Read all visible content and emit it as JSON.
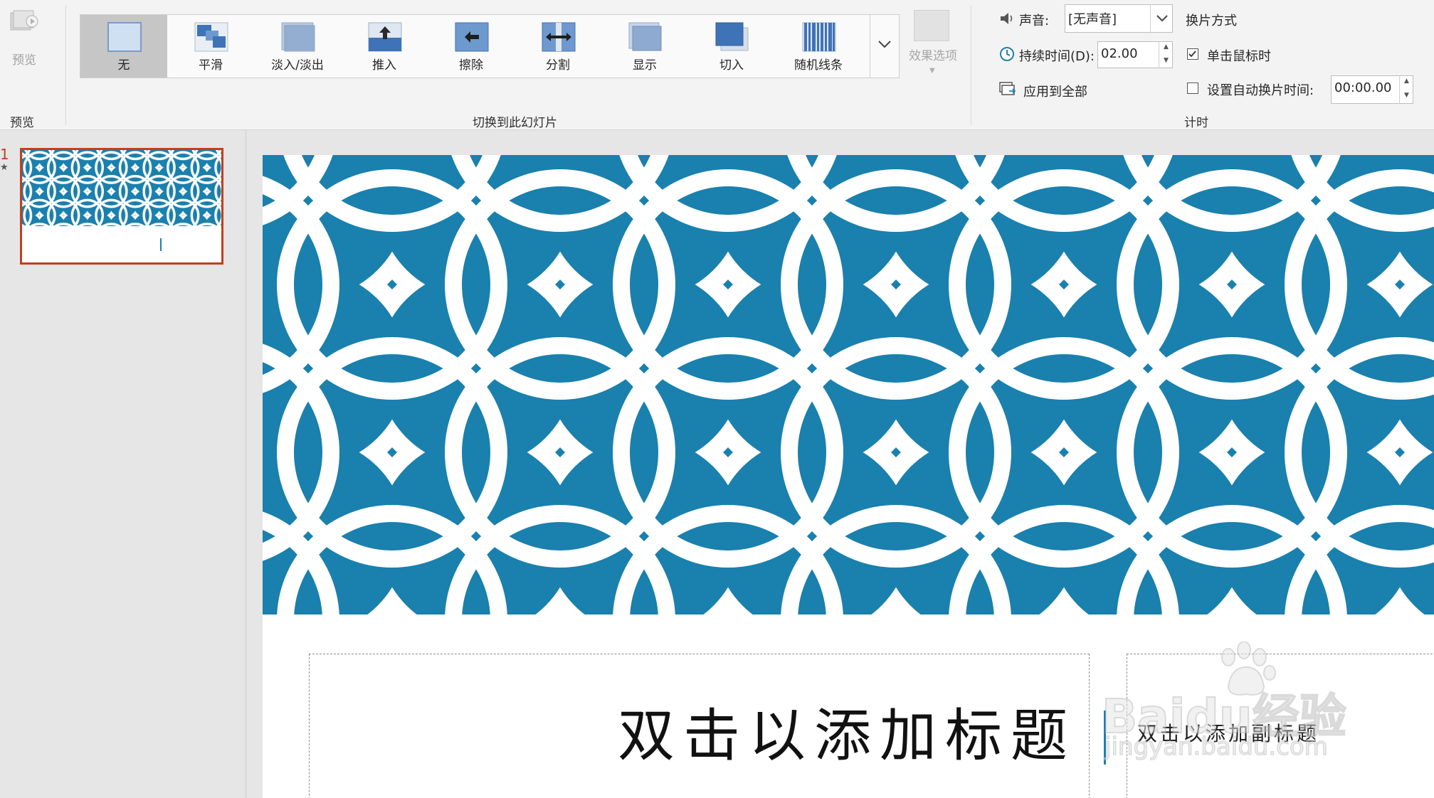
{
  "ribbon": {
    "preview": {
      "button_label": "预览",
      "group_label": "预览"
    },
    "transitions": {
      "group_label": "切换到此幻灯片",
      "selected_index": 0,
      "items": [
        {
          "label": "无",
          "icon": "none-transition-icon"
        },
        {
          "label": "平滑",
          "icon": "morph-transition-icon"
        },
        {
          "label": "淡入/淡出",
          "icon": "fade-transition-icon"
        },
        {
          "label": "推入",
          "icon": "push-transition-icon"
        },
        {
          "label": "擦除",
          "icon": "wipe-transition-icon"
        },
        {
          "label": "分割",
          "icon": "split-transition-icon"
        },
        {
          "label": "显示",
          "icon": "reveal-transition-icon"
        },
        {
          "label": "切入",
          "icon": "cut-transition-icon"
        },
        {
          "label": "随机线条",
          "icon": "random-bars-transition-icon"
        }
      ],
      "effect_options_label": "效果选项"
    },
    "timing": {
      "group_label": "计时",
      "sound_label": "声音:",
      "sound_value": "[无声音]",
      "duration_label": "持续时间(D):",
      "duration_value": "02.00",
      "apply_all_label": "应用到全部",
      "advance_header": "换片方式",
      "on_click_label": "单击鼠标时",
      "on_click_checked": true,
      "after_label": "设置自动换片时间:",
      "after_checked": false,
      "after_value": "00:00.00"
    }
  },
  "thumbnails": {
    "slide_number": "1",
    "animation_marker": "★"
  },
  "slide": {
    "title_placeholder": "双击以添加标题",
    "subtitle_placeholder": "双击以添加副标题",
    "pattern_color": "#1a80ad",
    "pattern_ring_color": "#ffffff"
  },
  "watermark": {
    "main": "Baidu经验",
    "sub": "jingyan.baidu.com"
  },
  "colors": {
    "accent": "#c43e1c",
    "cursor": "#1f7fae"
  }
}
